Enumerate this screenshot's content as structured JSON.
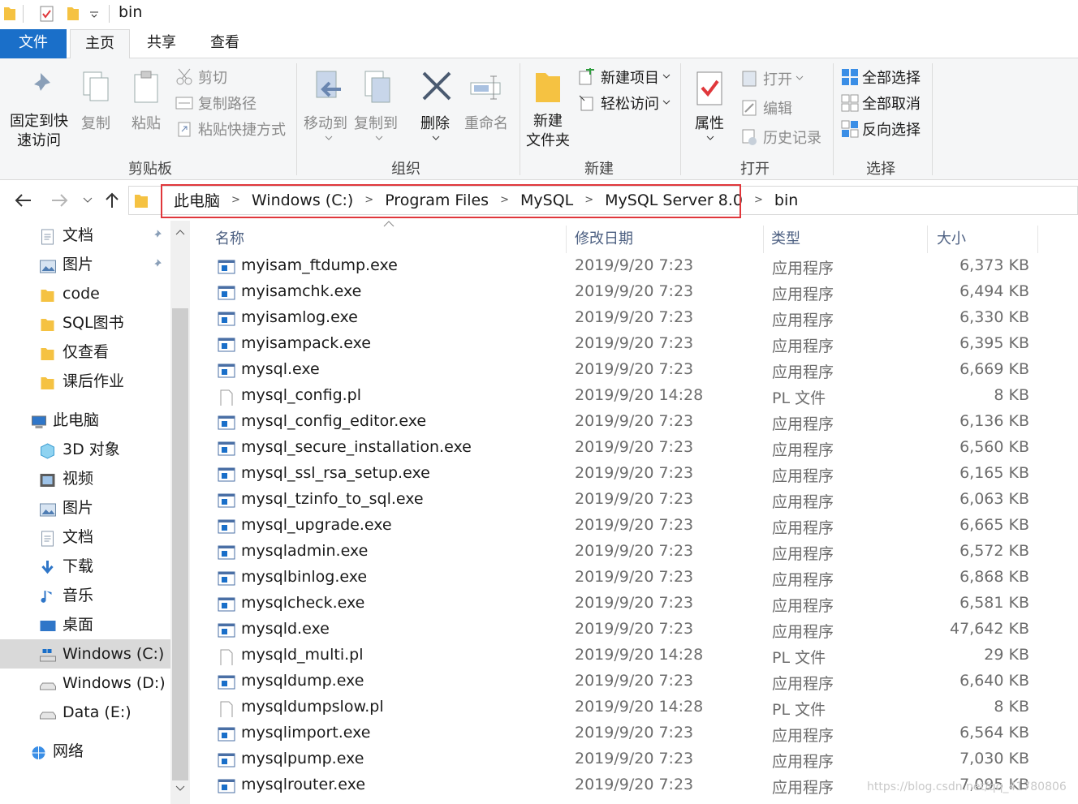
{
  "window": {
    "title": "bin"
  },
  "tabs": {
    "file": "文件",
    "home": "主页",
    "share": "共享",
    "view": "查看"
  },
  "ribbon": {
    "pin": "固定到快\n速访问",
    "copy": "复制",
    "paste": "粘贴",
    "cut": "剪切",
    "copy_path": "复制路径",
    "paste_shortcut": "粘贴快捷方式",
    "move_to": "移动到",
    "copy_to": "复制到",
    "delete": "删除",
    "rename": "重命名",
    "new_folder": "新建\n文件夹",
    "new_item": "新建项目",
    "easy_access": "轻松访问",
    "properties": "属性",
    "open": "打开",
    "edit": "编辑",
    "history": "历史记录",
    "select_all": "全部选择",
    "select_none": "全部取消",
    "invert": "反向选择",
    "groups": {
      "clipboard": "剪贴板",
      "organize": "组织",
      "new": "新建",
      "open": "打开",
      "select": "选择"
    }
  },
  "address": {
    "crumbs": [
      "此电脑",
      "Windows (C:)",
      "Program Files",
      "MySQL",
      "MySQL Server 8.0",
      "bin"
    ]
  },
  "nav": {
    "quick": [
      {
        "label": "文档",
        "icon": "document-icon",
        "pinned": true
      },
      {
        "label": "图片",
        "icon": "picture-icon",
        "pinned": true
      },
      {
        "label": "code",
        "icon": "folder-icon"
      },
      {
        "label": "SQL图书",
        "icon": "folder-icon"
      },
      {
        "label": "仅查看",
        "icon": "folder-icon"
      },
      {
        "label": "课后作业",
        "icon": "folder-icon"
      }
    ],
    "this_pc": "此电脑",
    "pc": [
      {
        "label": "3D 对象",
        "icon": "3d-objects-icon"
      },
      {
        "label": "视频",
        "icon": "video-icon"
      },
      {
        "label": "图片",
        "icon": "picture-icon"
      },
      {
        "label": "文档",
        "icon": "document-icon"
      },
      {
        "label": "下载",
        "icon": "download-icon"
      },
      {
        "label": "音乐",
        "icon": "music-icon"
      },
      {
        "label": "桌面",
        "icon": "desktop-icon"
      },
      {
        "label": "Windows (C:)",
        "icon": "drive-c-icon",
        "selected": true
      },
      {
        "label": "Windows (D:)",
        "icon": "drive-icon"
      },
      {
        "label": "Data (E:)",
        "icon": "drive-icon"
      }
    ],
    "network": "网络"
  },
  "columns": {
    "name": "名称",
    "date": "修改日期",
    "type": "类型",
    "size": "大小"
  },
  "files": [
    {
      "name": "myisam_ftdump.exe",
      "date": "2019/9/20 7:23",
      "type": "应用程序",
      "size": "6,373 KB",
      "kind": "exe"
    },
    {
      "name": "myisamchk.exe",
      "date": "2019/9/20 7:23",
      "type": "应用程序",
      "size": "6,494 KB",
      "kind": "exe"
    },
    {
      "name": "myisamlog.exe",
      "date": "2019/9/20 7:23",
      "type": "应用程序",
      "size": "6,330 KB",
      "kind": "exe"
    },
    {
      "name": "myisampack.exe",
      "date": "2019/9/20 7:23",
      "type": "应用程序",
      "size": "6,395 KB",
      "kind": "exe"
    },
    {
      "name": "mysql.exe",
      "date": "2019/9/20 7:23",
      "type": "应用程序",
      "size": "6,669 KB",
      "kind": "exe"
    },
    {
      "name": "mysql_config.pl",
      "date": "2019/9/20 14:28",
      "type": "PL 文件",
      "size": "8 KB",
      "kind": "pl"
    },
    {
      "name": "mysql_config_editor.exe",
      "date": "2019/9/20 7:23",
      "type": "应用程序",
      "size": "6,136 KB",
      "kind": "exe"
    },
    {
      "name": "mysql_secure_installation.exe",
      "date": "2019/9/20 7:23",
      "type": "应用程序",
      "size": "6,560 KB",
      "kind": "exe"
    },
    {
      "name": "mysql_ssl_rsa_setup.exe",
      "date": "2019/9/20 7:23",
      "type": "应用程序",
      "size": "6,165 KB",
      "kind": "exe"
    },
    {
      "name": "mysql_tzinfo_to_sql.exe",
      "date": "2019/9/20 7:23",
      "type": "应用程序",
      "size": "6,063 KB",
      "kind": "exe"
    },
    {
      "name": "mysql_upgrade.exe",
      "date": "2019/9/20 7:23",
      "type": "应用程序",
      "size": "6,665 KB",
      "kind": "exe"
    },
    {
      "name": "mysqladmin.exe",
      "date": "2019/9/20 7:23",
      "type": "应用程序",
      "size": "6,572 KB",
      "kind": "exe"
    },
    {
      "name": "mysqlbinlog.exe",
      "date": "2019/9/20 7:23",
      "type": "应用程序",
      "size": "6,868 KB",
      "kind": "exe"
    },
    {
      "name": "mysqlcheck.exe",
      "date": "2019/9/20 7:23",
      "type": "应用程序",
      "size": "6,581 KB",
      "kind": "exe"
    },
    {
      "name": "mysqld.exe",
      "date": "2019/9/20 7:23",
      "type": "应用程序",
      "size": "47,642 KB",
      "kind": "exe"
    },
    {
      "name": "mysqld_multi.pl",
      "date": "2019/9/20 14:28",
      "type": "PL 文件",
      "size": "29 KB",
      "kind": "pl"
    },
    {
      "name": "mysqldump.exe",
      "date": "2019/9/20 7:23",
      "type": "应用程序",
      "size": "6,640 KB",
      "kind": "exe"
    },
    {
      "name": "mysqldumpslow.pl",
      "date": "2019/9/20 14:28",
      "type": "PL 文件",
      "size": "8 KB",
      "kind": "pl"
    },
    {
      "name": "mysqlimport.exe",
      "date": "2019/9/20 7:23",
      "type": "应用程序",
      "size": "6,564 KB",
      "kind": "exe"
    },
    {
      "name": "mysqlpump.exe",
      "date": "2019/9/20 7:23",
      "type": "应用程序",
      "size": "7,030 KB",
      "kind": "exe"
    },
    {
      "name": "mysqlrouter.exe",
      "date": "2019/9/20 7:23",
      "type": "应用程序",
      "size": "7,095 KB",
      "kind": "exe"
    }
  ],
  "watermark": "https://blog.csdn.net/qq_41780806",
  "colors": {
    "accent": "#1a6fc9",
    "highlight": "#e0373b",
    "folder": "#f5c242"
  }
}
